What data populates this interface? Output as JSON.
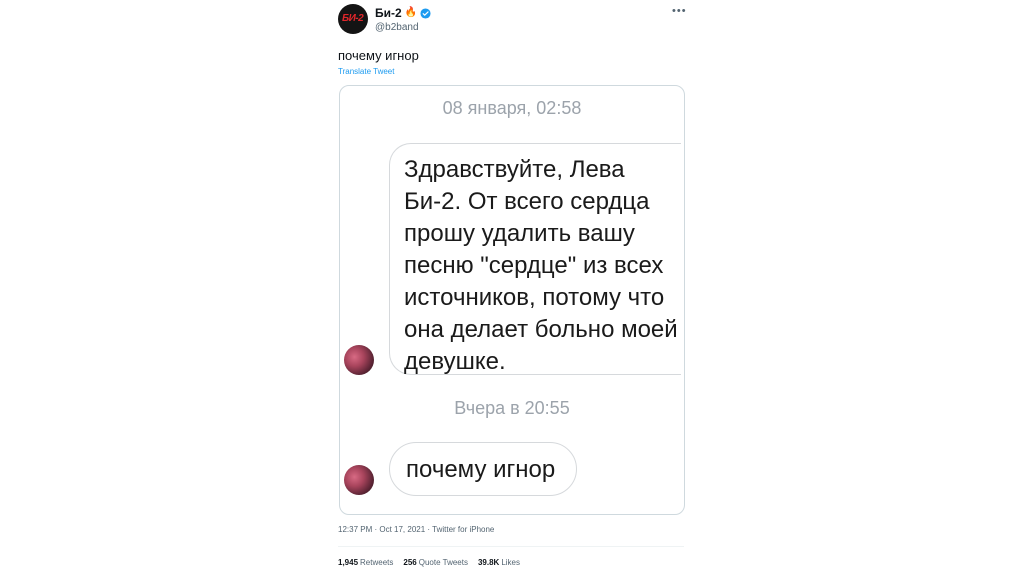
{
  "header": {
    "avatar_text": "БИ-2",
    "display_name": "Би-2",
    "name_emoji": "🔥",
    "handle": "@b2band",
    "more_label": "•••"
  },
  "tweet": {
    "text": "почему игнор",
    "translate_label": "Translate Tweet"
  },
  "screenshot": {
    "timestamp_1": "08 января, 02:58",
    "message_1_lines": [
      "Здравствуйте, Лева",
      "Би-2. От всего сердца",
      "прошу удалить вашу",
      "песню \"сердце\" из всех",
      "источников, потому что",
      "она делает больно моей",
      "девушке."
    ],
    "timestamp_2": "Вчера в 20:55",
    "message_2": "почему игнор"
  },
  "meta": {
    "time_line": "12:37 PM · Oct 17, 2021 · Twitter for iPhone"
  },
  "stats": {
    "retweets_count": "1,945",
    "retweets_label": "Retweets",
    "quotes_count": "256",
    "quotes_label": "Quote Tweets",
    "likes_count": "39.8K",
    "likes_label": "Likes"
  },
  "colors": {
    "link": "#1d9bf0",
    "verified": "#1d9bf0",
    "muted": "#536471"
  }
}
